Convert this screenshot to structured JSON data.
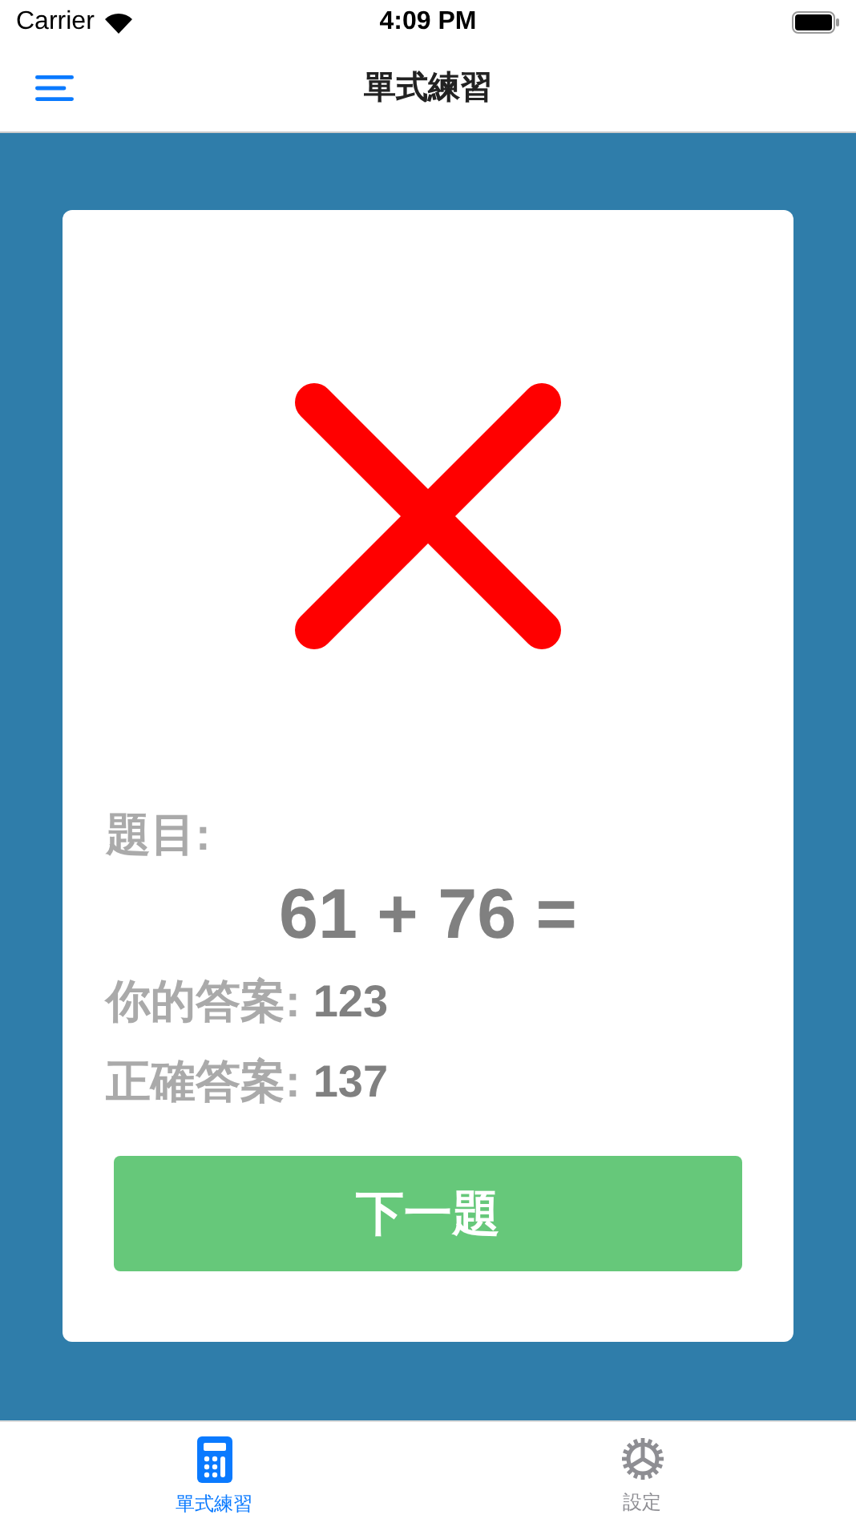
{
  "status_bar": {
    "carrier": "Carrier",
    "time": "4:09 PM"
  },
  "nav": {
    "title": "單式練習"
  },
  "result": {
    "correct": false,
    "question_label": "題目:",
    "question": "61 + 76 =",
    "answers": [
      {
        "label": "你的答案:",
        "value": "123"
      },
      {
        "label": "正確答案:",
        "value": "137"
      }
    ],
    "next_button": "下一題"
  },
  "tabs": [
    {
      "label": "單式練習",
      "kind": "calculator",
      "selected": true
    },
    {
      "label": "設定",
      "kind": "gear",
      "selected": false
    }
  ]
}
